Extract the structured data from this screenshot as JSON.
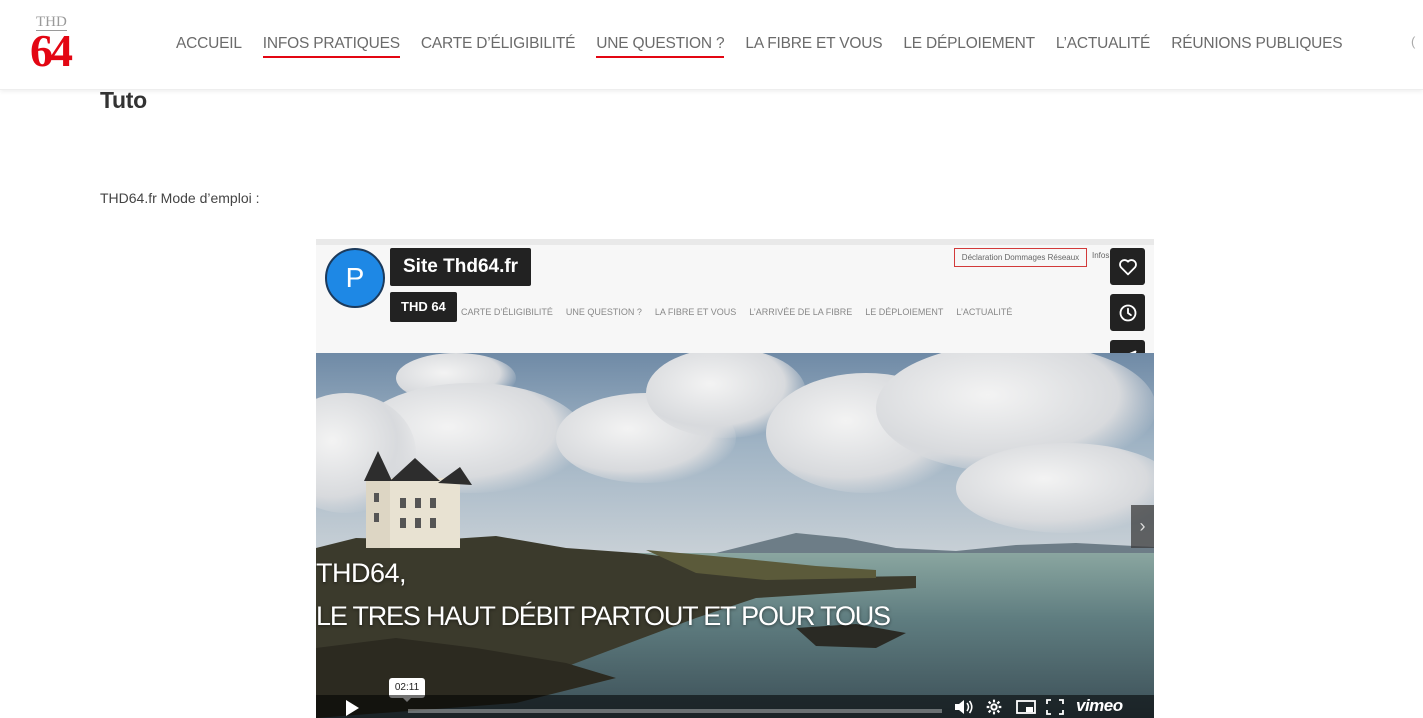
{
  "header": {
    "logo": {
      "small_text": "THD",
      "big_text": "64"
    },
    "nav": [
      {
        "label": "ACCUEIL",
        "underlined": false
      },
      {
        "label": "INFOS PRATIQUES",
        "underlined": true
      },
      {
        "label": "CARTE D’ÉLIGIBILITÉ",
        "underlined": false
      },
      {
        "label": "UNE QUESTION ?",
        "underlined": true
      },
      {
        "label": "LA FIBRE ET VOUS",
        "underlined": false
      },
      {
        "label": "LE DÉPLOIEMENT",
        "underlined": false
      },
      {
        "label": "L’ACTUALITÉ",
        "underlined": false
      },
      {
        "label": "RÉUNIONS PUBLIQUES",
        "underlined": false
      }
    ],
    "edge_mark": "("
  },
  "content": {
    "title": "Tuto",
    "intro": "THD64.fr Mode d’emploi :"
  },
  "video": {
    "avatar_letter": "P",
    "title": "Site Thd64.fr",
    "byline": "THD 64",
    "embedded_site": {
      "declaration_link": "Déclaration Dommages Réseaux",
      "info_clip": "Infos",
      "nav": [
        "CARTE D’ÉLIGIBILITÉ",
        "UNE QUESTION ?",
        "LA FIBRE ET VOUS",
        "L’ARRIVÉE DE LA FIBRE",
        "LE DÉPLOIEMENT",
        "L’ACTUALITÉ"
      ]
    },
    "overlay_line1": "THD64,",
    "overlay_line2": "LE TRES HAUT DÉBIT PARTOUT ET POUR TOUS",
    "side_buttons": [
      "heart-icon",
      "clock-icon",
      "send-icon"
    ],
    "player": {
      "timestamp": "02:11",
      "progress": 0,
      "brand": "vimeo"
    },
    "colors": {
      "accent": "#e30613",
      "player_blue": "#00adef",
      "avatar_blue": "#1e88e5"
    }
  }
}
